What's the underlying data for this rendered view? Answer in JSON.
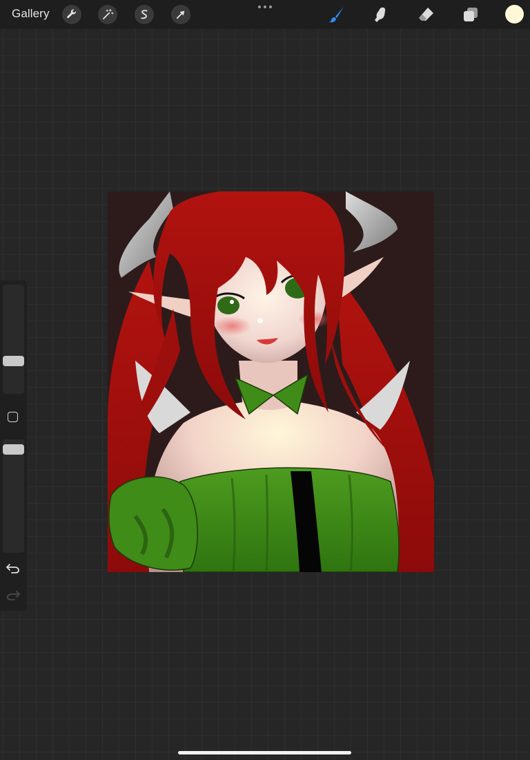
{
  "topbar": {
    "gallery_label": "Gallery",
    "left_tools": [
      {
        "name": "actions",
        "icon": "wrench-icon"
      },
      {
        "name": "adjustments",
        "icon": "magic-wand-icon"
      },
      {
        "name": "selection",
        "icon": "selection-s-icon"
      },
      {
        "name": "transform",
        "icon": "arrow-cursor-icon"
      }
    ],
    "more_icon": "ellipsis-icon",
    "right_tools": [
      {
        "name": "brush",
        "icon": "brush-icon",
        "active": true
      },
      {
        "name": "smudge",
        "icon": "smudge-finger-icon",
        "active": false
      },
      {
        "name": "eraser",
        "icon": "eraser-icon",
        "active": false
      },
      {
        "name": "layers",
        "icon": "layers-icon",
        "active": false
      }
    ],
    "current_color": "#fff8d8",
    "accent_color": "#2f8dff"
  },
  "sidebar": {
    "size_slider_icon": "brush-size-slider",
    "opacity_slider_icon": "opacity-slider",
    "modify_icon": "square-modify-icon",
    "undo_icon": "undo-arrow-icon",
    "redo_icon": "redo-arrow-icon"
  },
  "canvas": {
    "subject": "artwork-canvas",
    "palette": {
      "background": "#2d1b1b",
      "hair": "#a1110f",
      "skin": "#f2d8cf",
      "outfit": "#3f8c18",
      "horn": "#a8a8a8",
      "eyes": "#2f6b16"
    }
  }
}
